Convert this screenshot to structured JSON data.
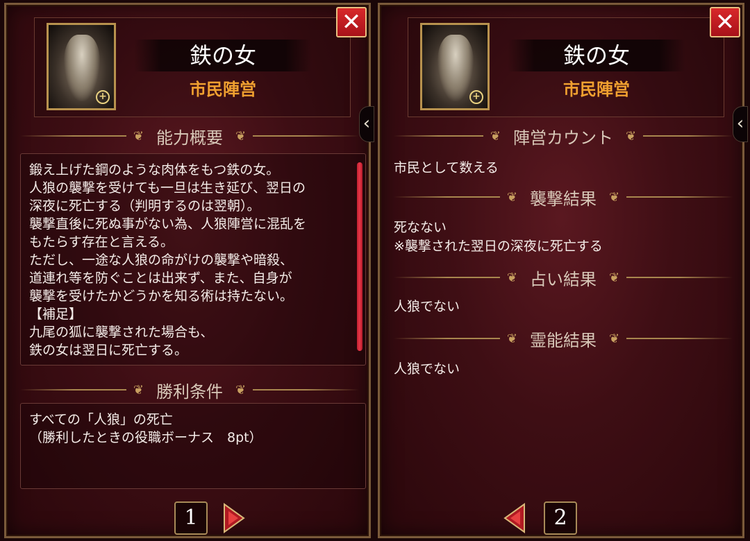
{
  "panel1": {
    "role_name": "鉄の女",
    "faction": "市民陣営",
    "section1_title": "能力概要",
    "ability_text": "鍛え上げた鋼のような肉体をもつ鉄の女。\n人狼の襲撃を受けても一旦は生き延び、翌日の\n深夜に死亡する（判明するのは翌朝）。\n襲撃直後に死ぬ事がない為、人狼陣営に混乱を\nもたらす存在と言える。\nただし、一途な人狼の命がけの襲撃や暗殺、\n道連れ等を防ぐことは出来ず、また、自身が\n襲撃を受けたかどうかを知る術は持たない。\n【補足】\n九尾の狐に襲撃された場合も、\n鉄の女は翌日に死亡する。",
    "section2_title": "勝利条件",
    "win_text": "すべての「人狼」の死亡\n（勝利したときの役職ボーナス　8pt）",
    "page": "1"
  },
  "panel2": {
    "role_name": "鉄の女",
    "faction": "市民陣営",
    "sections": [
      {
        "title": "陣営カウント",
        "text": "市民として数える"
      },
      {
        "title": "襲撃結果",
        "text": "死なない\n※襲撃された翌日の深夜に死亡する"
      },
      {
        "title": "占い結果",
        "text": "人狼でない"
      },
      {
        "title": "霊能結果",
        "text": "人狼でない"
      }
    ],
    "page": "2"
  },
  "icons": {
    "close": "close-icon",
    "zoom": "zoom-icon",
    "side_tab": "chevron-left-icon",
    "next": "arrow-right-icon",
    "prev": "arrow-left-icon"
  },
  "colors": {
    "faction": "#f0a030",
    "close_bg": "#c81e24",
    "gold_border": "#a8864e"
  }
}
